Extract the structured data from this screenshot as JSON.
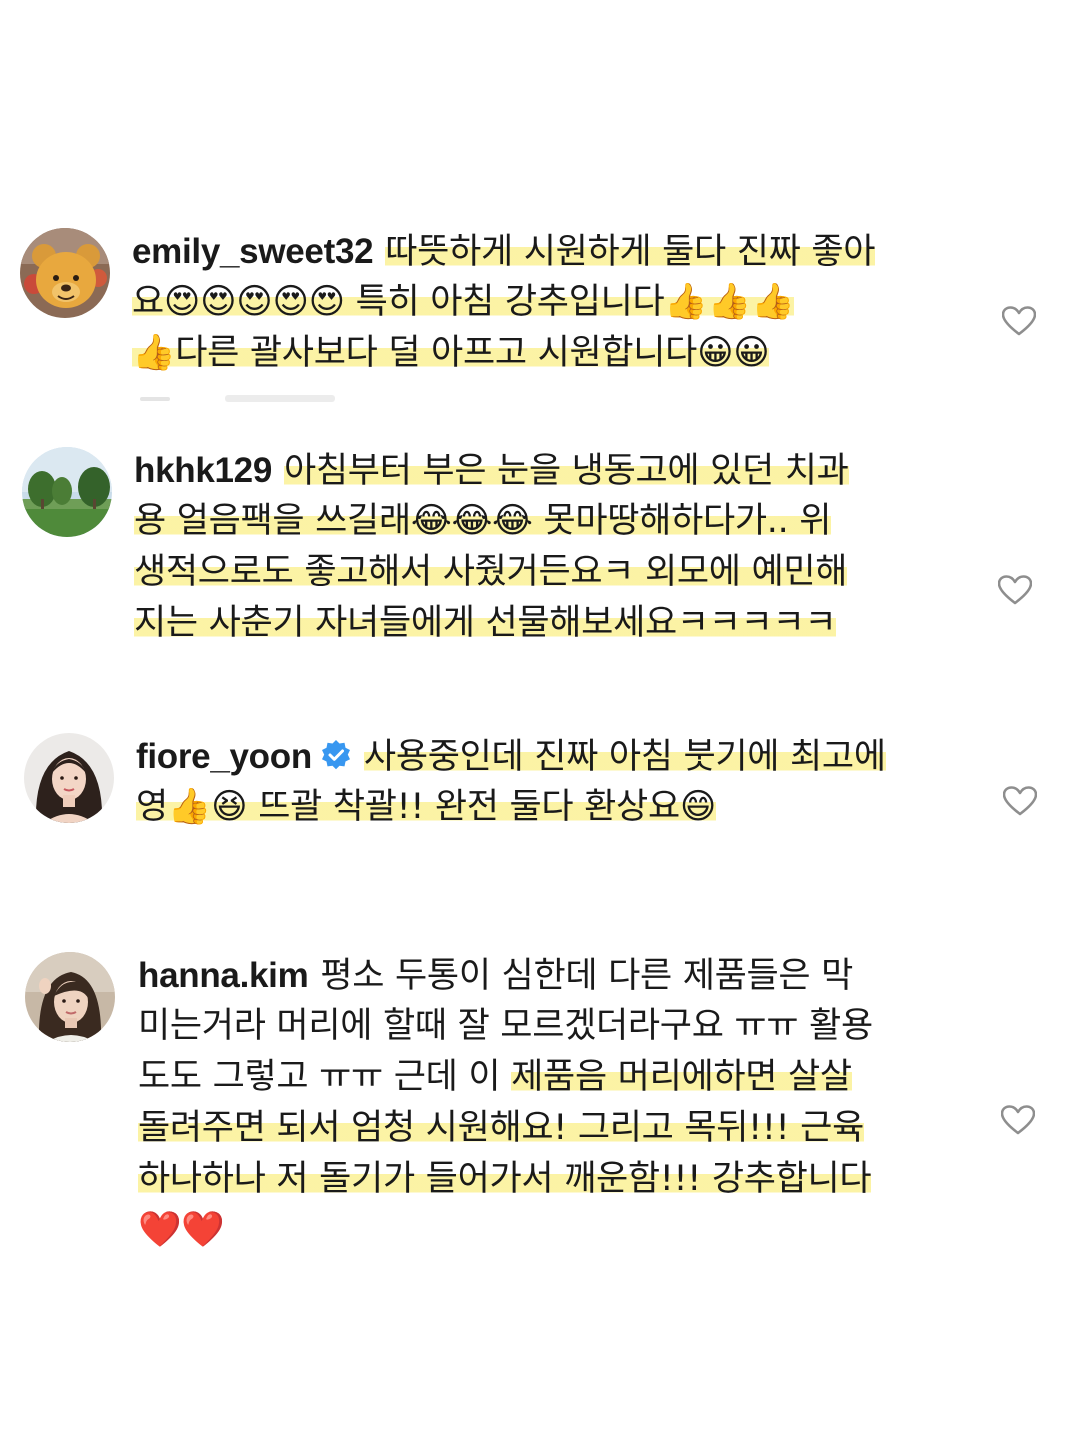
{
  "comments": [
    {
      "username": "emily_sweet32",
      "lines": [
        {
          "plain": "",
          "highlight": "따뜻하게 시원하게 둘다 진짜 좋아"
        },
        {
          "plain": "",
          "highlight": "요😍😍😍😍😍 특히 아침 강추입니다👍👍👍"
        },
        {
          "plain": "",
          "highlight": "👍다른 괄사보다 덜 아프고 시원합니다😀😀"
        }
      ],
      "avatar_icon": "winnie-the-pooh-avatar"
    },
    {
      "username": "hkhk129",
      "lines": [
        {
          "plain": "",
          "highlight": "아침부터 부은 눈을 냉동고에 있던 치과"
        },
        {
          "plain": "",
          "highlight": "용 얼음팩을 쓰길래😂😂😂 못마땅해하다가.. 위"
        },
        {
          "plain": "",
          "highlight": "생적으로도 좋고해서 사줬거든요ㅋ 외모에 예민해"
        },
        {
          "plain": "",
          "highlight": "지는 사춘기 자녀들에게 선물해보세요ㅋㅋㅋㅋㅋ"
        }
      ],
      "avatar_icon": "park-landscape-avatar"
    },
    {
      "username": "fiore_yoon",
      "verified": true,
      "lines": [
        {
          "plain": "",
          "highlight": "사용중인데 진짜 아침 붓기에 최고에"
        },
        {
          "plain": "",
          "highlight": "영👍😆 뜨괄 착괄!! 완전 둘다 환상요😄"
        }
      ],
      "avatar_icon": "woman-portrait-avatar"
    },
    {
      "username": "hanna.kim",
      "lines": [
        {
          "plain": "평소 두통이 심한데 다른 제품들은 막",
          "highlight": ""
        },
        {
          "plain": "미는거라 머리에 할때 잘 모르겠더라구요 ㅠㅠ 활용",
          "highlight": ""
        },
        {
          "plain": "도도 그렇고 ㅠㅠ 근데 이 ",
          "highlight": "제품음 머리에하면 살살"
        },
        {
          "plain": "",
          "highlight": "돌려주면 되서 엄청 시원해요! 그리고 목뒤!!! 근육"
        },
        {
          "plain": "",
          "highlight": "하나하나 저 돌기가 들어가서 깨운함!!! 강추합니다"
        },
        {
          "plain": "❤️❤️",
          "highlight": ""
        }
      ],
      "avatar_icon": "woman-selfie-avatar"
    }
  ],
  "icons": {
    "like": "heart-outline-icon",
    "verified": "verified-badge-icon"
  },
  "colors": {
    "text": "#1a1a1a",
    "highlight": "#faee82",
    "verified": "#3897f0",
    "heart_outline": "#8e8e8e"
  }
}
